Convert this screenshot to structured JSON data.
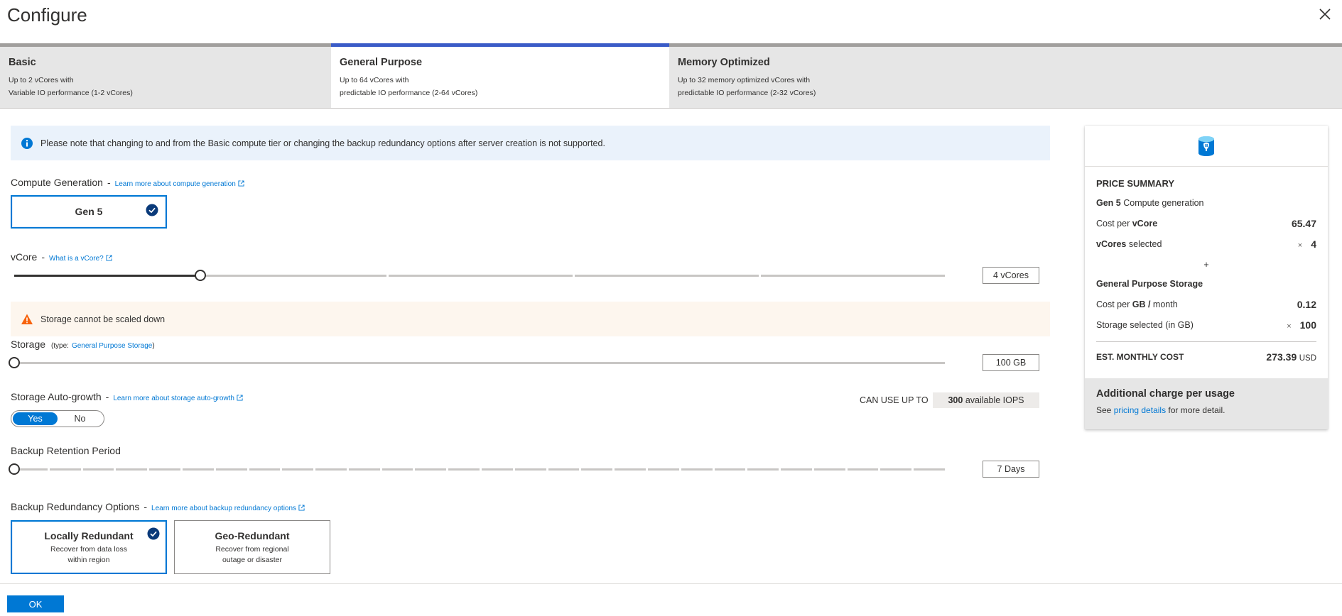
{
  "header": {
    "title": "Configure"
  },
  "tabs": [
    {
      "name": "Basic",
      "line1": "Up to 2 vCores with",
      "line2": "Variable IO performance (1-2 vCores)"
    },
    {
      "name": "General Purpose",
      "line1": "Up to 64 vCores with",
      "line2": "predictable IO performance (2-64 vCores)"
    },
    {
      "name": "Memory Optimized",
      "line1": "Up to 32 memory optimized vCores with",
      "line2": "predictable IO performance (2-32 vCores)"
    }
  ],
  "active_tab": "General Purpose",
  "info_banner": "Please note that changing to and from the Basic compute tier or changing the backup redundancy options after server creation is not supported.",
  "compute": {
    "label": "Compute Generation",
    "sep": "-",
    "link": "Learn more about compute generation",
    "option": "Gen 5"
  },
  "vcore": {
    "label": "vCore",
    "sep": "-",
    "link": "What is a vCore?",
    "value": "4 vCores",
    "fraction": 0.2
  },
  "warning": "Storage cannot be scaled down",
  "storage": {
    "label": "Storage",
    "type_prefix": "(type:",
    "type_link": "General Purpose Storage",
    "type_suffix": ")",
    "value": "100 GB",
    "fraction": 0
  },
  "autogrowth": {
    "label": "Storage Auto-growth",
    "sep": "-",
    "link": "Learn more about storage auto-growth",
    "yes": "Yes",
    "no": "No",
    "selected": "Yes"
  },
  "iops": {
    "label": "CAN USE UP TO",
    "value": "300",
    "unit": "available IOPS"
  },
  "backup": {
    "label": "Backup Retention Period",
    "value": "7 Days",
    "fraction": 0
  },
  "redundancy": {
    "label": "Backup Redundancy Options",
    "sep": "-",
    "link": "Learn more about backup redundancy options",
    "options": [
      {
        "title": "Locally Redundant",
        "line1": "Recover from data loss",
        "line2": "within region",
        "selected": true
      },
      {
        "title": "Geo-Redundant",
        "line1": "Recover from regional",
        "line2": "outage or disaster",
        "selected": false
      }
    ]
  },
  "summary": {
    "title": "PRICE SUMMARY",
    "gen_bold": "Gen 5",
    "gen_text": "Compute generation",
    "cost_vcore_text": "Cost per",
    "cost_vcore_bold": "vCore",
    "cost_vcore_value": "65.47",
    "vcores_bold": "vCores",
    "vcores_text": "selected",
    "vcores_mult": "×",
    "vcores_value": "4",
    "plus": "+",
    "storage_title": "General Purpose Storage",
    "cost_gb_text": "Cost per",
    "cost_gb_bold": "GB /",
    "cost_gb_text2": "month",
    "cost_gb_value": "0.12",
    "storage_sel_text": "Storage selected (in GB)",
    "storage_mult": "×",
    "storage_value": "100",
    "est_label": "EST. MONTHLY COST",
    "est_value": "273.39",
    "est_unit": "USD",
    "extra_title": "Additional charge per usage",
    "extra_pre": "See",
    "extra_link": "pricing details",
    "extra_post": "for more detail."
  },
  "footer": {
    "ok_label": "OK"
  },
  "colors": {
    "accent": "#0078d4",
    "active_tab_border": "#3a5bc7",
    "info_bg": "#eaf2fb",
    "warn_bg": "#fdf6ee",
    "warn_icon": "#f7630c"
  }
}
